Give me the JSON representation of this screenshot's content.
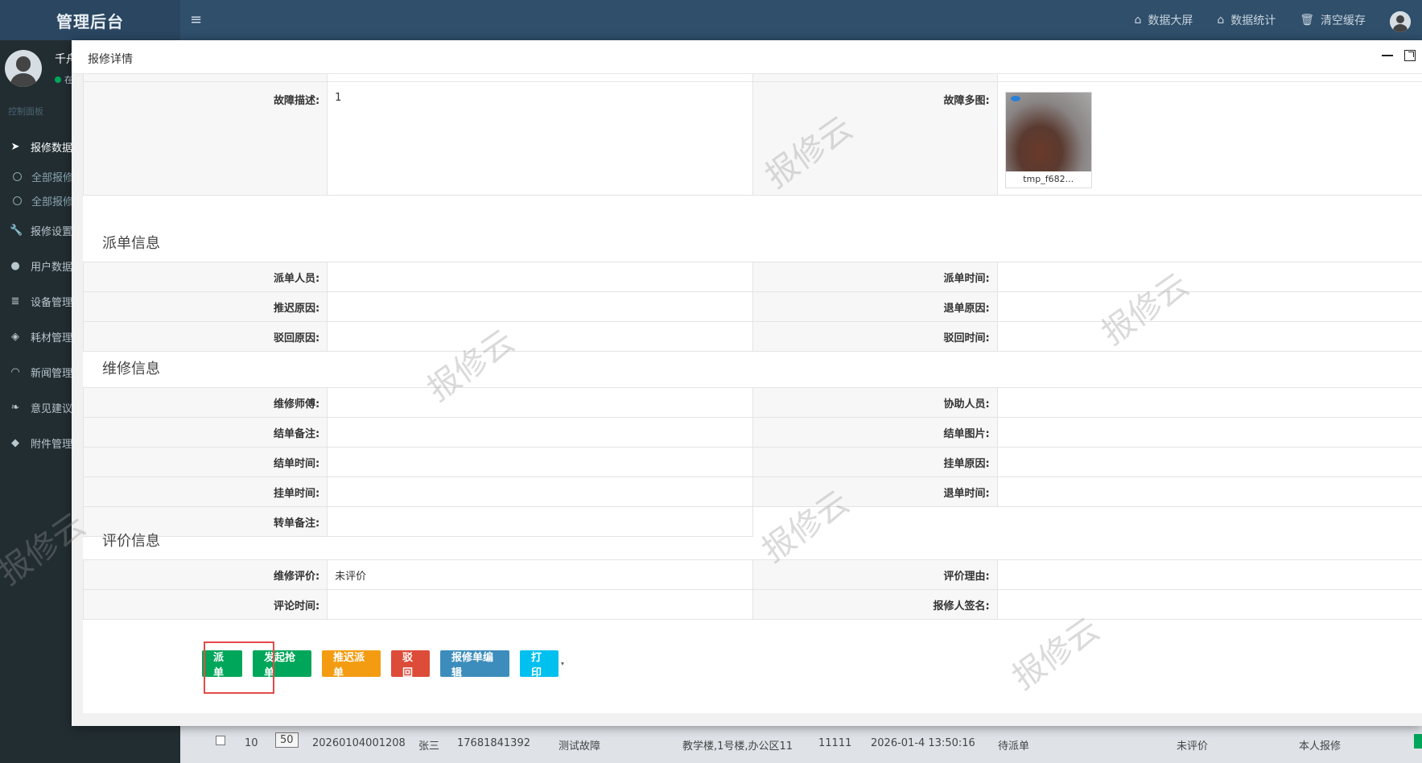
{
  "header": {
    "brand": "管理后台",
    "nav": [
      {
        "label": "数据大屏",
        "icon": "home-icon"
      },
      {
        "label": "数据统计",
        "icon": "home-icon"
      },
      {
        "label": "清空缓存",
        "icon": "trash-icon"
      }
    ]
  },
  "sidebar": {
    "user_name": "千舟",
    "status": "在",
    "section": "控制面板",
    "items": [
      {
        "label": "报修数据",
        "icon": "send-icon"
      },
      {
        "label": "全部报修",
        "sub": true
      },
      {
        "label": "全部报修",
        "sub": true
      },
      {
        "label": "报修设置",
        "icon": "wrench-icon"
      },
      {
        "label": "用户数据",
        "icon": "user-icon"
      },
      {
        "label": "设备管理",
        "icon": "database-icon"
      },
      {
        "label": "耗材管理",
        "icon": "cube-icon"
      },
      {
        "label": "新闻管理",
        "icon": "rss-icon"
      },
      {
        "label": "意见建议",
        "icon": "leaf-icon"
      },
      {
        "label": "附件管理",
        "icon": "tag-icon"
      }
    ]
  },
  "bg_row": {
    "index": "10",
    "page": "50",
    "order_no": "20260104001208",
    "name": "张三",
    "phone": "17681841392",
    "fault": "测试故障",
    "address": "教学楼,1号楼,办公区11",
    "code": "11111",
    "time": "2026-01-4 13:50:16",
    "status": "待派单",
    "eval": "未评价",
    "source": "本人报修"
  },
  "modal": {
    "title": "报修详情",
    "fault": {
      "desc_label": "故障描述:",
      "desc_value": "1",
      "images_label": "故障多图:",
      "image_caption": "tmp_f682..."
    },
    "dispatch": {
      "title": "派单信息",
      "rows": [
        [
          "派单人员:",
          "",
          "派单时间:",
          ""
        ],
        [
          "推迟原因:",
          "",
          "退单原因:",
          ""
        ],
        [
          "驳回原因:",
          "",
          "驳回时间:",
          ""
        ]
      ]
    },
    "repair": {
      "title": "维修信息",
      "rows": [
        [
          "维修师傅:",
          "",
          "协助人员:",
          ""
        ],
        [
          "结单备注:",
          "",
          "结单图片:",
          ""
        ],
        [
          "结单时间:",
          "",
          "挂单原因:",
          ""
        ],
        [
          "挂单时间:",
          "",
          "退单时间:",
          ""
        ],
        [
          "转单备注:",
          "",
          "",
          ""
        ]
      ]
    },
    "evaluation": {
      "title": "评价信息",
      "rows": [
        [
          "维修评价:",
          "未评价",
          "评价理由:",
          ""
        ],
        [
          "评论时间:",
          "",
          "报修人签名:",
          ""
        ]
      ]
    },
    "buttons": [
      "派单",
      "发起抢单",
      "推迟派单",
      "驳回",
      "报修单编辑",
      "打印"
    ],
    "watermark": "报修云"
  }
}
